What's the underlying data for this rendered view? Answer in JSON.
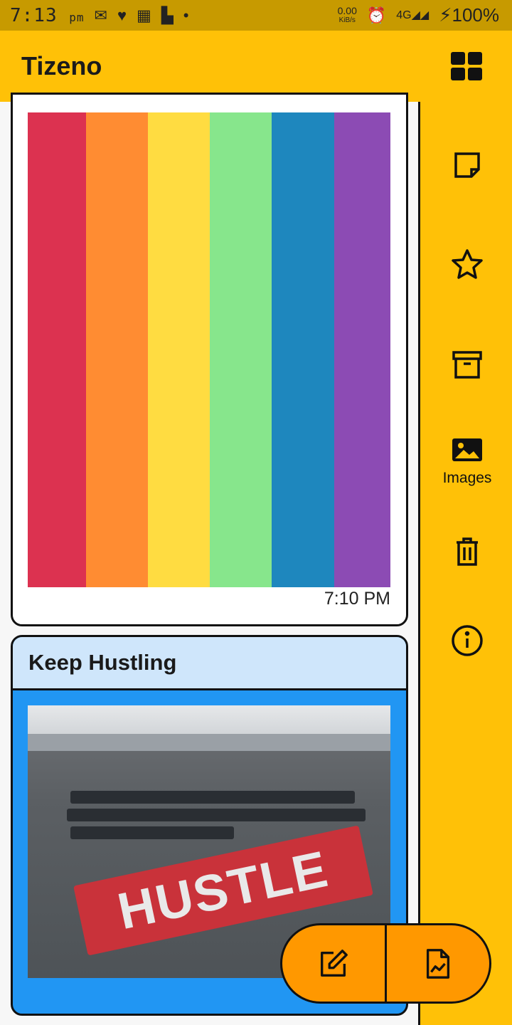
{
  "status_bar": {
    "time": "7:13",
    "ampm": "pm",
    "net_speed": "0.00",
    "net_unit": "KiB/s",
    "network": "4G",
    "battery": "100%"
  },
  "app_bar": {
    "title": "Tizeno",
    "view_toggle_icon": "grid-view-icon"
  },
  "rail": {
    "items": [
      {
        "icon": "note-icon",
        "label": ""
      },
      {
        "icon": "star-icon",
        "label": ""
      },
      {
        "icon": "archive-icon",
        "label": ""
      },
      {
        "icon": "image-icon",
        "label": "Images"
      },
      {
        "icon": "trash-icon",
        "label": ""
      },
      {
        "icon": "info-icon",
        "label": ""
      }
    ]
  },
  "notes": [
    {
      "time": "7:10 PM",
      "stripe_colors": [
        "#dc3250",
        "#ff8c32",
        "#ffdc41",
        "#87e68c",
        "#1e87be",
        "#8c4bb4"
      ]
    },
    {
      "title": "Keep Hustling",
      "image_text": "HUSTLE",
      "color": "#2196f3"
    }
  ],
  "fab": {
    "new_note_icon": "edit-icon",
    "new_image_note_icon": "image-file-icon"
  },
  "colors": {
    "accent": "#ffc107",
    "status_bar": "#c79a00",
    "fab": "#ff9800"
  }
}
